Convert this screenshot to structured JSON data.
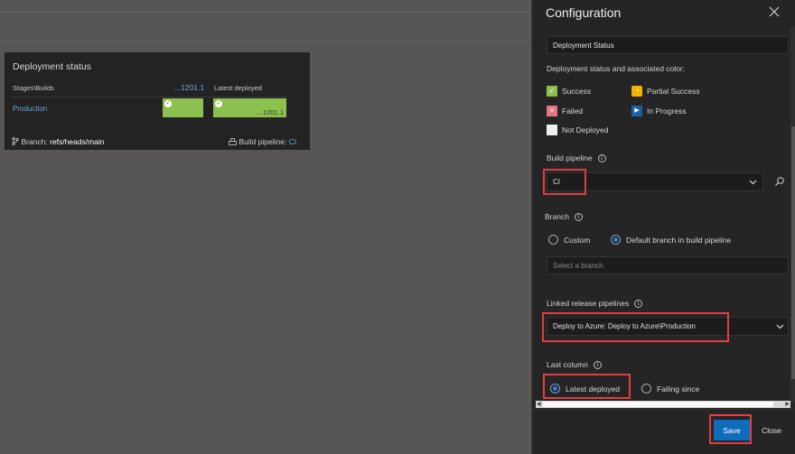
{
  "background": {
    "color": "#575655"
  },
  "widget": {
    "title": "Deployment status",
    "col_stage": "Stages\\Builds",
    "col_build": "...1201.1",
    "col_latest": "Latest deployed",
    "stage_name": "Production",
    "tile2_label": "...1201.1",
    "branch_label": "Branch:",
    "branch_value": "refs/heads/main",
    "pipeline_label": "Build pipeline:",
    "pipeline_value": "CI",
    "success_color": "#8cc04f"
  },
  "config": {
    "title": "Configuration",
    "name_value": "Deployment Status",
    "status_heading": "Deployment status and associated color:",
    "legend": [
      {
        "label": "Success",
        "icon": "check-icon",
        "color": "#8cc04f"
      },
      {
        "label": "Partial Success",
        "icon": "warning-icon",
        "color": "#f2b400"
      },
      {
        "label": "Failed",
        "icon": "x-icon",
        "color": "#e8737f"
      },
      {
        "label": "In Progress",
        "icon": "play-icon",
        "color": "#1d5fa5"
      },
      {
        "label": "Not Deployed",
        "icon": "none",
        "color": "#f0f0f0"
      }
    ],
    "build_pipeline_label": "Build pipeline",
    "build_pipeline_value": "CI",
    "branch_label": "Branch",
    "branch_option_custom": "Custom",
    "branch_option_default": "Default branch in build pipeline",
    "branch_placeholder": "Select a branch.",
    "linked_label": "Linked release pipelines",
    "linked_value": "Deploy to Azure: Deploy to Azure\\Production",
    "last_column_label": "Last column",
    "last_option_latest": "Latest deployed",
    "last_option_failing": "Failing since",
    "save_label": "Save",
    "close_label": "Close",
    "accent_color": "#0f6cbd",
    "highlight_color": "#e04040"
  }
}
